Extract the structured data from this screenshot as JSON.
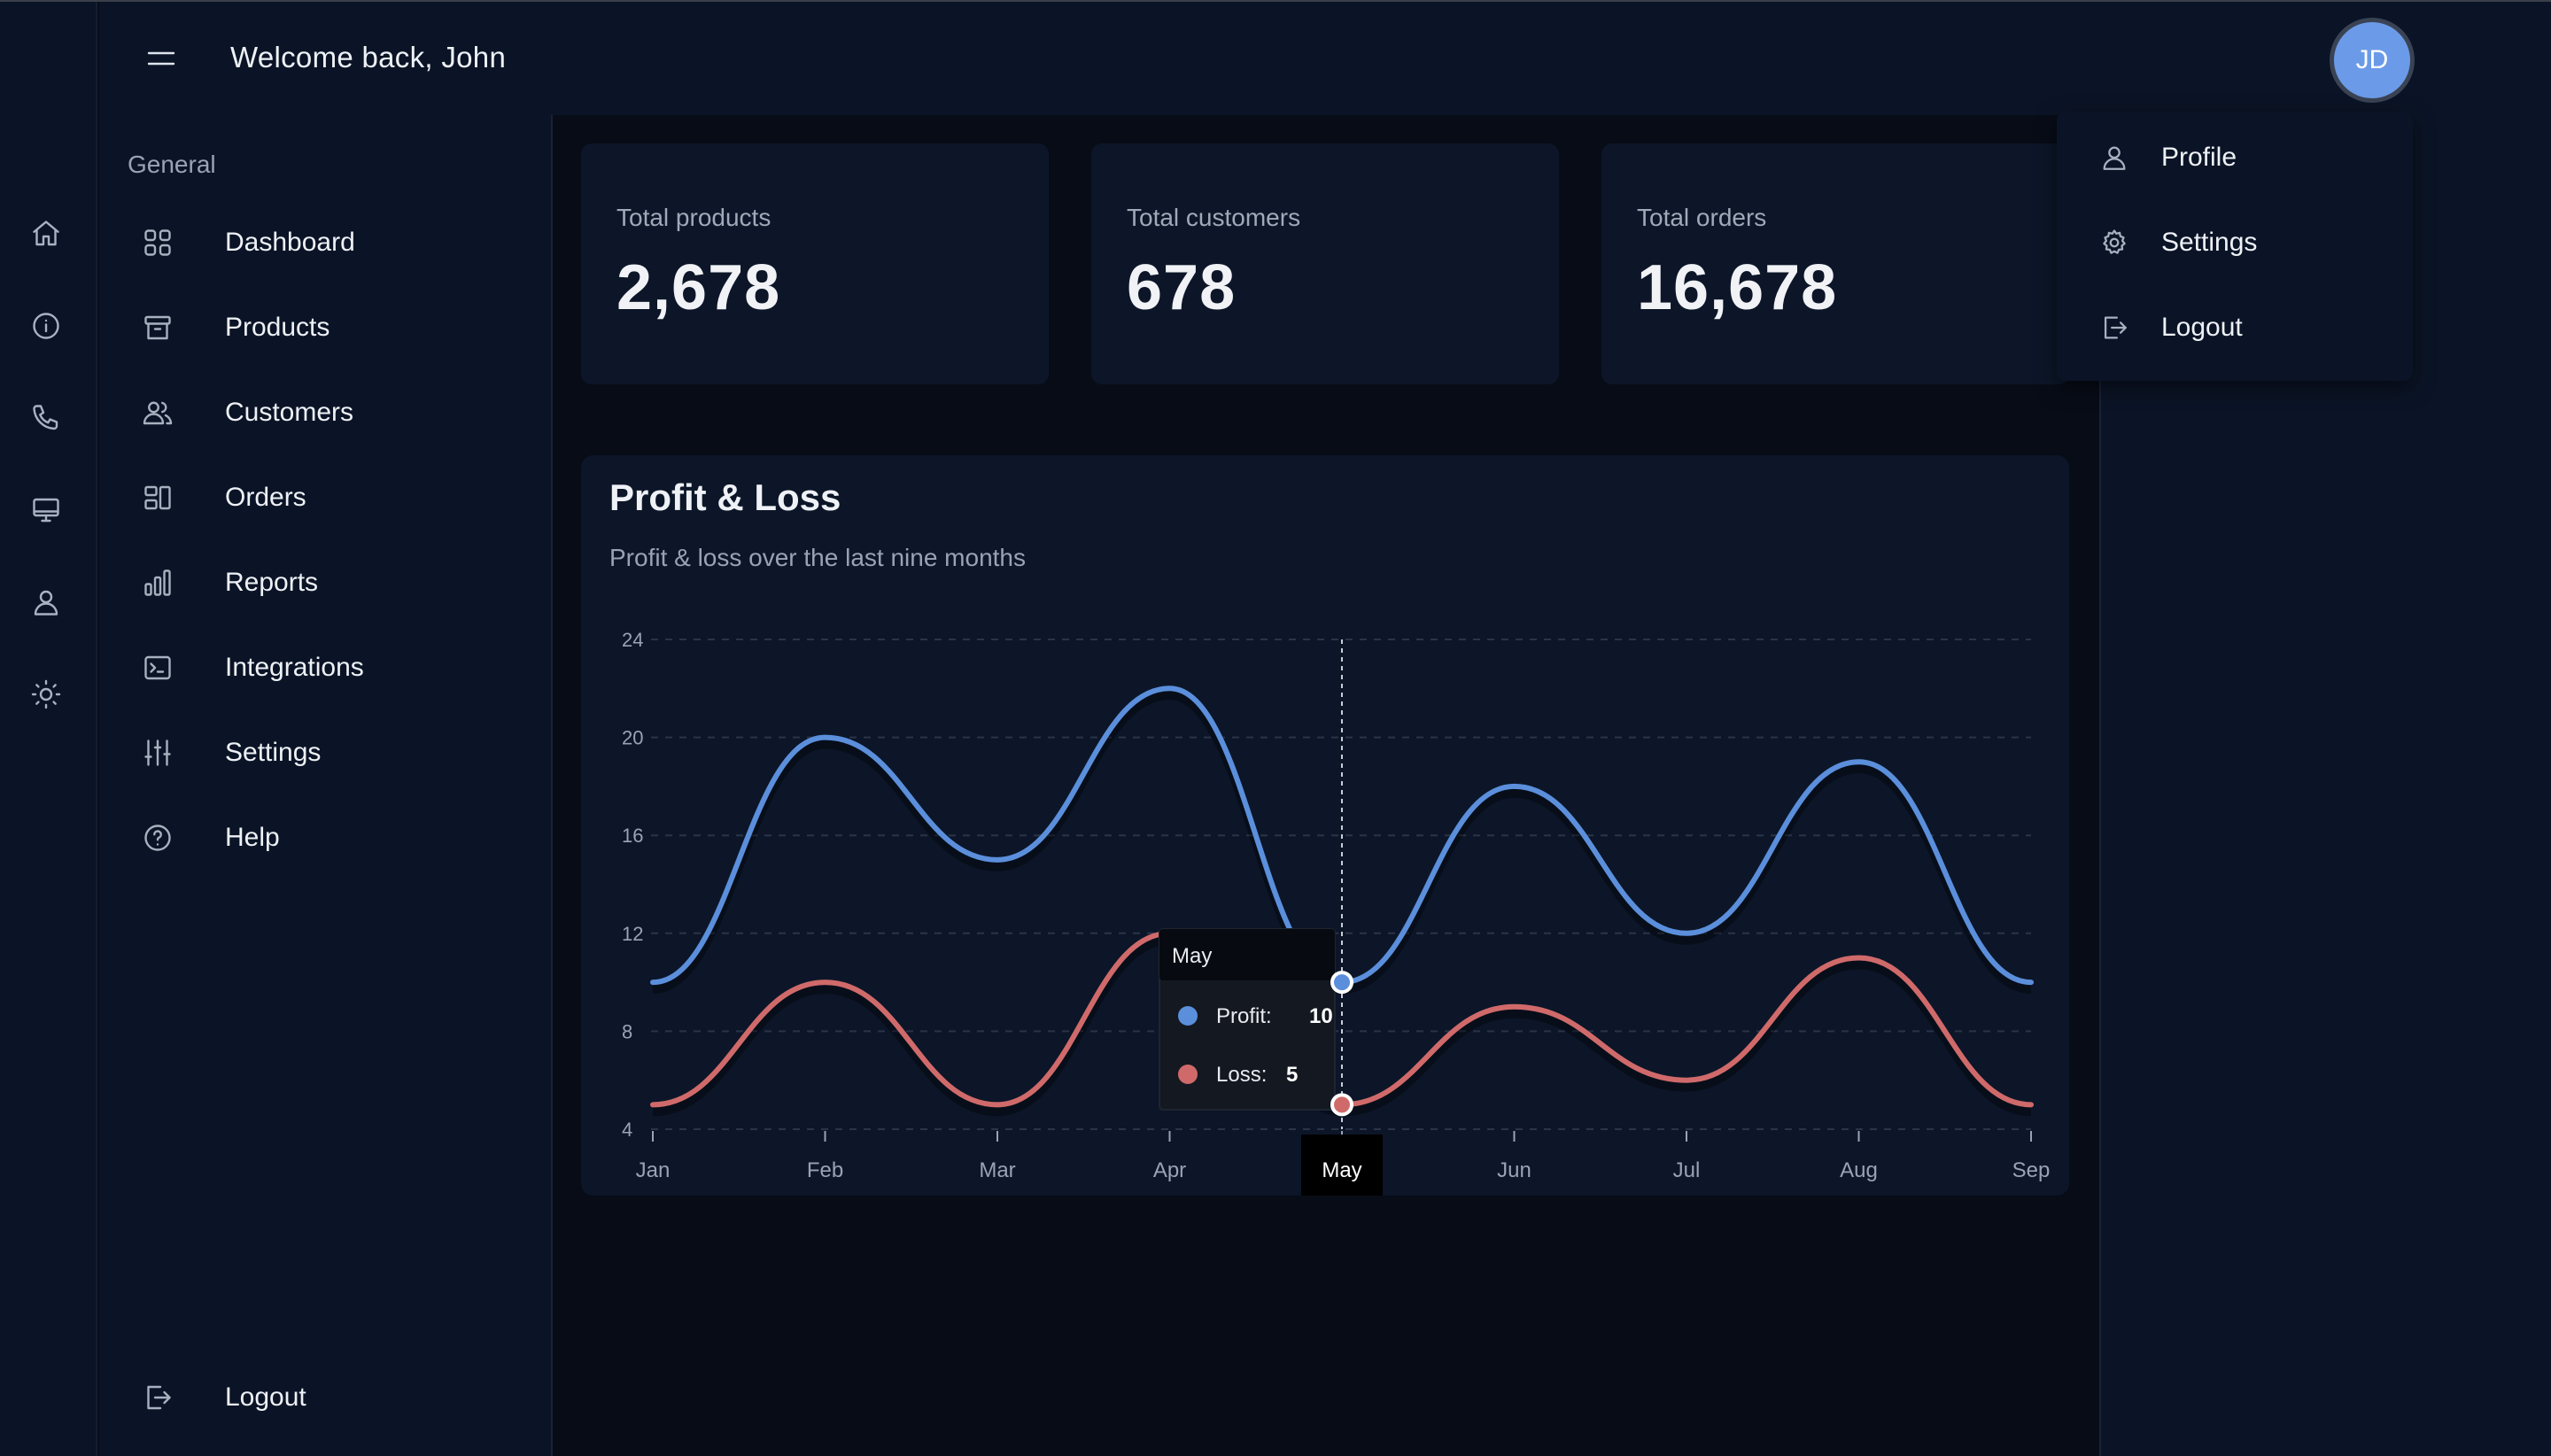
{
  "header": {
    "welcome": "Welcome back, John",
    "avatar_initials": "JD"
  },
  "rail": {
    "icons": [
      "home-icon",
      "info-icon",
      "phone-icon",
      "monitor-icon",
      "user-icon",
      "sun-icon"
    ]
  },
  "sidebar": {
    "heading": "General",
    "items": [
      {
        "label": "Dashboard",
        "icon": "grid-icon"
      },
      {
        "label": "Products",
        "icon": "archive-icon"
      },
      {
        "label": "Customers",
        "icon": "users-icon"
      },
      {
        "label": "Orders",
        "icon": "layout-icon"
      },
      {
        "label": "Reports",
        "icon": "bar-chart-icon"
      },
      {
        "label": "Integrations",
        "icon": "terminal-icon"
      },
      {
        "label": "Settings",
        "icon": "sliders-icon"
      },
      {
        "label": "Help",
        "icon": "help-icon"
      }
    ],
    "logout": "Logout"
  },
  "stats": [
    {
      "label": "Total products",
      "value": "2,678"
    },
    {
      "label": "Total customers",
      "value": "678"
    },
    {
      "label": "Total orders",
      "value": "16,678"
    }
  ],
  "chart": {
    "title": "Profit & Loss",
    "subtitle": "Profit & loss over the last nine months"
  },
  "chart_data": {
    "type": "line",
    "title": "Profit & Loss",
    "subtitle": "Profit & loss over the last nine months",
    "categories": [
      "Jan",
      "Feb",
      "Mar",
      "Apr",
      "May",
      "Jun",
      "Jul",
      "Aug",
      "Sep"
    ],
    "series": [
      {
        "name": "Profit",
        "values": [
          10,
          20,
          15,
          22,
          10,
          18,
          12,
          19,
          10
        ],
        "color": "#5b8fdc"
      },
      {
        "name": "Loss",
        "values": [
          5,
          10,
          5,
          12,
          5,
          9,
          6,
          11,
          5
        ],
        "color": "#d06a6a"
      }
    ],
    "ylim": [
      4,
      24
    ],
    "yticks": [
      4,
      8,
      12,
      16,
      20,
      24
    ],
    "grid": true,
    "curve": "smooth",
    "active_category": "May",
    "tooltip": {
      "title": "May",
      "rows": [
        {
          "name": "Profit",
          "value": "10"
        },
        {
          "name": "Loss",
          "value": "5"
        }
      ]
    }
  },
  "dropdown": {
    "items": [
      {
        "label": "Profile",
        "icon": "user-icon"
      },
      {
        "label": "Settings",
        "icon": "gear-icon"
      },
      {
        "label": "Logout",
        "icon": "logout-icon"
      }
    ]
  },
  "colors": {
    "background": "#070c17",
    "panel": "#0b1426",
    "card": "#0c1628",
    "profit": "#5b8fdc",
    "loss": "#d06a6a",
    "avatar": "#6b9be8"
  }
}
